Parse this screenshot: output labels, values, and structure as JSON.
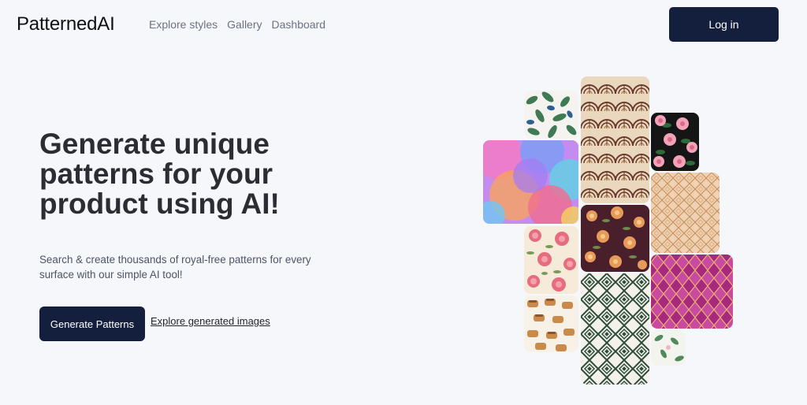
{
  "header": {
    "logo": "PatternedAI",
    "nav": [
      "Explore styles",
      "Gallery",
      "Dashboard"
    ],
    "login_label": "Log in"
  },
  "hero": {
    "title": "Generate unique patterns for your product using AI!",
    "subtitle": "Search & create thousands of royal-free patterns for every surface with our simple AI tool!",
    "cta_primary": "Generate Patterns",
    "cta_secondary": "Explore generated images"
  },
  "gallery": {
    "tiles": [
      "tropical-leaves-pattern",
      "art-deco-fan-pattern",
      "rose-on-black-pattern",
      "colorful-circles-pattern",
      "peach-geometric-pattern",
      "autumn-flowers-pattern",
      "rose-floral-pattern",
      "magenta-diamond-pattern",
      "baked-goods-pattern",
      "green-diamond-pattern",
      "small-green-floral-pattern"
    ]
  },
  "colors": {
    "background": "#f6f7fb",
    "button": "#141f3d",
    "button_text": "#ffffff",
    "text": "#2b2d33",
    "muted_text": "#6b7280"
  }
}
